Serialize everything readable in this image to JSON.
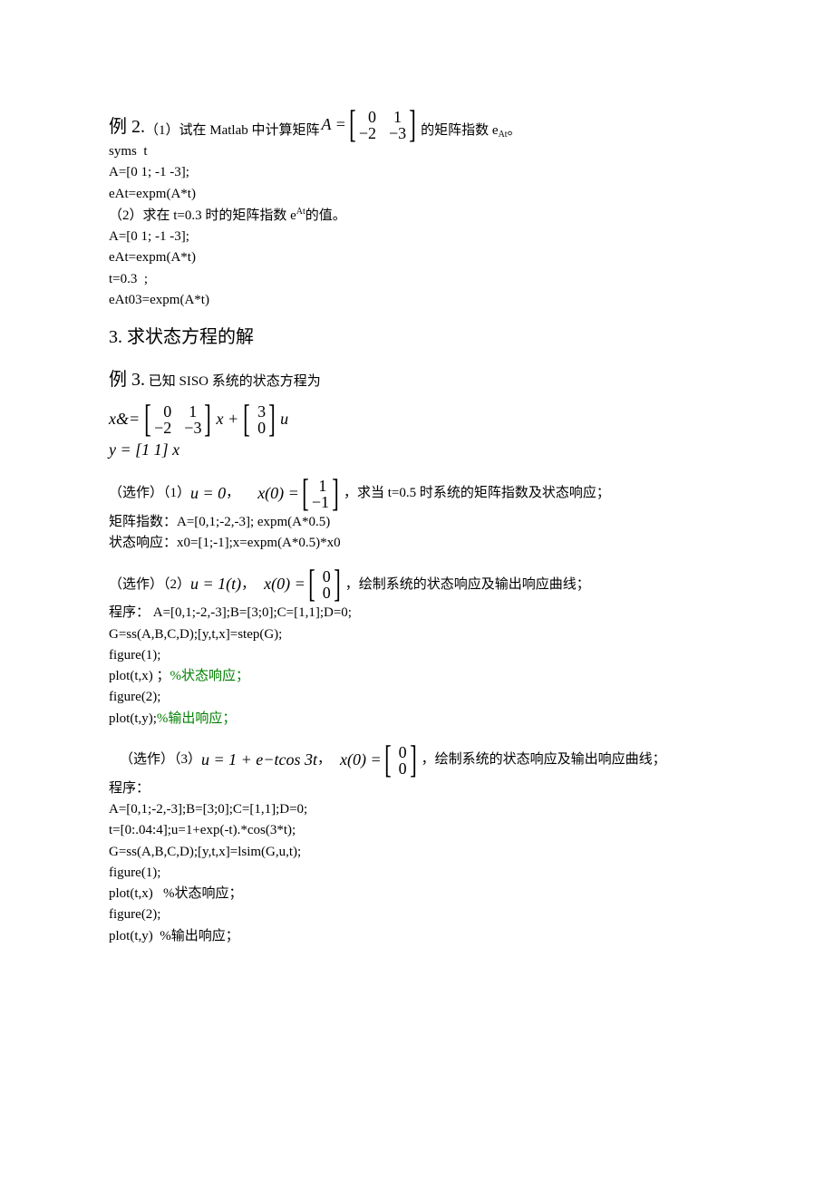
{
  "ex2": {
    "label": "例 2.",
    "p1_a": "（1）试在 Matlab 中计算矩阵 ",
    "A_eq": "A =",
    "m_r1c1": "0",
    "m_r1c2": "1",
    "m_r2c1": "−2",
    "m_r2c2": "−3",
    "p1_b": " 的矩阵指数 e",
    "p1_sup": "At",
    "p1_c": "。",
    "code1": "syms  t",
    "code2": "A=[0 1; -1 -3];",
    "code3": "eAt=expm(A*t)",
    "p2": "（2）求在 t=0.3 时的矩阵指数 e",
    "p2_sup": "At",
    "p2_b": "的值。",
    "code4": "A=[0 1; -1 -3];",
    "code5": "eAt=expm(A*t)",
    "code6": "t=0.3  ;",
    "code7": "eAt03=expm(A*t)"
  },
  "sec3": {
    "title": "3. 求状态方程的解"
  },
  "ex3": {
    "label": "例 3.",
    "intro": "已知 SISO 系统的状态方程为",
    "xd": "x&=",
    "m1_r1c1": "0",
    "m1_r1c2": "1",
    "m1_r2c1": "−2",
    "m1_r2c2": "−3",
    "x_mid": "x +",
    "m2_r1": "3",
    "m2_r2": "0",
    "u_end": "u",
    "y_eq": "y = [1   1] x",
    "p1_pre": "（选作）（1）",
    "u0": "u = 0",
    "comma": "，",
    "x0_label": "x(0) =",
    "x0a_r1": "1",
    "x0a_r2": "−1",
    "p1_tail": "，求当 t=0.5 时系统的矩阵指数及状态响应；",
    "p1_line1": "矩阵指数：A=[0,1;-2,-3]; expm(A*0.5)",
    "p1_line2": "状态响应：x0=[1;-1];x=expm(A*0.5)*x0",
    "p2_pre": "（选作）（2）",
    "u1t": "u = 1(t)",
    "x0b_r1": "0",
    "x0b_r2": "0",
    "p2_tail": "，绘制系统的状态响应及输出响应曲线；",
    "p2_l1": "程序： A=[0,1;-2,-3];B=[3;0];C=[1,1];D=0;",
    "p2_l2": "G=ss(A,B,C,D);[y,t,x]=step(G);",
    "p2_l3": "figure(1);",
    "p2_l4a": "plot(t,x) ；",
    "p2_l4b": "%状态响应；",
    "p2_l5": "figure(2);",
    "p2_l6a": "plot(t,y);",
    "p2_l6b": "%输出响应；",
    "p3_pre": "（选作）（3）",
    "u3": "u = 1 + e",
    "u3_sup": "−t",
    "u3_b": " cos 3t",
    "x0c_r1": "0",
    "x0c_r2": "0",
    "p3_tail": "，绘制系统的状态响应及输出响应曲线；",
    "p3_l1": "程序：",
    "p3_l2": "A=[0,1;-2,-3];B=[3;0];C=[1,1];D=0;",
    "p3_l3": "t=[0:.04:4];u=1+exp(-t).*cos(3*t);",
    "p3_l4": "G=ss(A,B,C,D);[y,t,x]=lsim(G,u,t);",
    "p3_l5": "figure(1);",
    "p3_l6": "plot(t,x)   %状态响应；",
    "p3_l7": "figure(2);",
    "p3_l8": "plot(t,y)  %输出响应；"
  }
}
